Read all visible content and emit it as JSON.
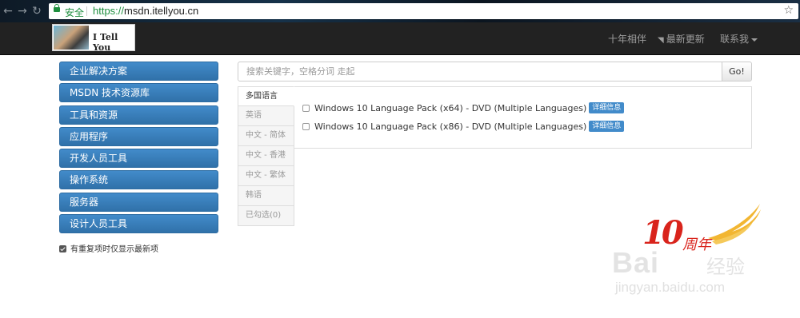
{
  "browser": {
    "secure_label": "安全",
    "url_scheme": "https://",
    "url_host": "msdn.itellyou.cn",
    "back_icon": "back-arrow-icon",
    "forward_icon": "forward-arrow-icon",
    "reload_icon": "reload-icon",
    "bookmark_icon": "star-icon"
  },
  "navbar": {
    "brand_text": "I Tell You",
    "links": [
      {
        "label": "十年相伴"
      },
      {
        "label": "最新更新",
        "icon": "rss-icon"
      },
      {
        "label": "联系我",
        "has_caret": true
      }
    ]
  },
  "sidebar": {
    "items": [
      {
        "label": "企业解决方案"
      },
      {
        "label": "MSDN 技术资源库"
      },
      {
        "label": "工具和资源"
      },
      {
        "label": "应用程序"
      },
      {
        "label": "开发人员工具"
      },
      {
        "label": "操作系统"
      },
      {
        "label": "服务器"
      },
      {
        "label": "设计人员工具"
      }
    ],
    "option": {
      "label": "有重复项时仅显示最新项",
      "checked": true
    }
  },
  "search": {
    "placeholder": "搜索关键字，空格分词 走起",
    "button": "Go!"
  },
  "lang_tabs": [
    {
      "label": "多国语言",
      "active": true
    },
    {
      "label": "英语"
    },
    {
      "label": "中文 - 简体"
    },
    {
      "label": "中文 - 香港"
    },
    {
      "label": "中文 - 繁体"
    },
    {
      "label": "韩语"
    },
    {
      "label": "已勾选(0)"
    }
  ],
  "files": [
    {
      "name": "Windows 10 Language Pack (x64) - DVD (Multiple Languages)",
      "badge": "详细信息"
    },
    {
      "name": "Windows 10 Language Pack (x86) - DVD (Multiple Languages)",
      "badge": "详细信息"
    }
  ],
  "watermark": {
    "number": "10",
    "anniv": "周年",
    "brand": "Bai",
    "brand_cn": "经验",
    "url": "jingyan.baidu.com"
  },
  "colors": {
    "primary": "#428bca",
    "navbar": "#222222",
    "secure": "#1e8e3e"
  }
}
